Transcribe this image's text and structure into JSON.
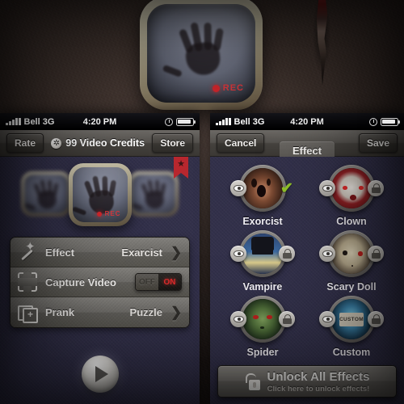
{
  "hero": {
    "icon_name": "ghost-hand-app-icon",
    "rec_label": "REC"
  },
  "left_phone": {
    "status_bar": {
      "carrier": "Bell 3G",
      "time": "4:20 PM",
      "signal_icon": "signal-bars-icon",
      "alarm_icon": "alarm-clock-icon",
      "battery_icon": "battery-icon"
    },
    "toolbar": {
      "rate_label": "Rate",
      "credits_icon": "coin-icon",
      "credits_label": "99 Video Credits",
      "store_label": "Store"
    },
    "carousel": {
      "badge_icon": "featured-ribbon-star-icon",
      "rec_label": "REC"
    },
    "rows": [
      {
        "icon": "magic-wand-icon",
        "label": "Effect",
        "value": "Exarcist",
        "accessory": "chevron-right-icon"
      },
      {
        "icon": "capture-frame-icon",
        "label": "Capture Video",
        "accessory": "toggle",
        "toggle_off": "OFF",
        "toggle_on": "ON",
        "toggle_state": "on"
      },
      {
        "icon": "prank-cards-icon",
        "label": "Prank",
        "value": "Puzzle",
        "accessory": "chevron-right-icon"
      }
    ],
    "play_button_icon": "play-icon"
  },
  "right_phone": {
    "status_bar": {
      "carrier": "Bell 3G",
      "time": "4:20 PM",
      "signal_icon": "signal-bars-icon",
      "alarm_icon": "alarm-clock-icon",
      "battery_icon": "battery-icon"
    },
    "toolbar": {
      "cancel_label": "Cancel",
      "title": "Effect",
      "save_label": "Save"
    },
    "effects": [
      {
        "name": "Exorcist",
        "face": "fa-exorcist",
        "left_icon": "eye-icon",
        "right_icon": "check-icon",
        "locked": false
      },
      {
        "name": "Clown",
        "face": "fa-clown",
        "left_icon": "eye-icon",
        "right_icon": "lock-icon",
        "locked": true
      },
      {
        "name": "Vampire",
        "face": "fa-vampire",
        "left_icon": "eye-icon",
        "right_icon": "lock-icon",
        "locked": true
      },
      {
        "name": "Scary Doll",
        "face": "fa-doll",
        "left_icon": "eye-icon",
        "right_icon": "lock-icon",
        "locked": true
      },
      {
        "name": "Spider",
        "face": "fa-spider",
        "left_icon": "eye-icon",
        "right_icon": "lock-icon",
        "locked": true
      },
      {
        "name": "Custom",
        "face": "fa-custom",
        "left_icon": "eye-icon",
        "right_icon": "lock-icon",
        "locked": true
      }
    ],
    "unlock": {
      "icon": "open-padlock-icon",
      "title": "Unlock All Effects",
      "subtitle": "Click here to unlock effects!"
    }
  },
  "colors": {
    "accent_red": "#b8272e",
    "toggle_on_red": "#e02a2a",
    "check_green": "#8fbe2a",
    "panel_bg": "#32304a"
  }
}
